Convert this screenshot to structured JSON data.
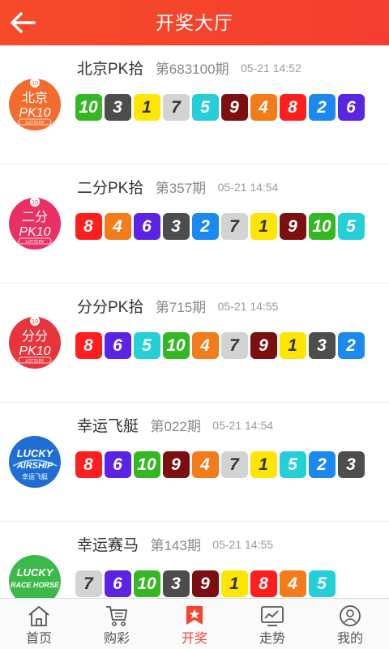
{
  "header": {
    "title": "开奖大厅",
    "back_icon": "arrow-left-icon"
  },
  "colors": {
    "accent": "#f4452e"
  },
  "lotteries": [
    {
      "name": "北京PK拾",
      "issue": "第683100期",
      "time": "05-21 14:52",
      "logo": {
        "line1": "北京",
        "line2": "PK10",
        "line3": "LOTTERY",
        "color": "#f26d2d"
      },
      "numbers": [
        "10",
        "3",
        "1",
        "7",
        "5",
        "9",
        "4",
        "8",
        "2",
        "6"
      ]
    },
    {
      "name": "二分PK拾",
      "issue": "第357期",
      "time": "05-21 14:54",
      "logo": {
        "line1": "二分",
        "line2": "PK10",
        "line3": "LOTTERY",
        "color": "#ea2f63"
      },
      "numbers": [
        "8",
        "4",
        "6",
        "3",
        "2",
        "7",
        "1",
        "9",
        "10",
        "5"
      ]
    },
    {
      "name": "分分PK拾",
      "issue": "第715期",
      "time": "05-21 14:55",
      "logo": {
        "line1": "分分",
        "line2": "PK10",
        "line3": "LOTTERY",
        "color": "#e7353d"
      },
      "numbers": [
        "8",
        "6",
        "5",
        "10",
        "4",
        "7",
        "9",
        "1",
        "3",
        "2"
      ]
    },
    {
      "name": "幸运飞艇",
      "issue": "第022期",
      "time": "05-21 14:54",
      "logo": {
        "line1": "LUCKY",
        "line2": "AIRSHIP",
        "line3": "幸运飞艇",
        "color": "#1f6fd3"
      },
      "numbers": [
        "8",
        "6",
        "10",
        "9",
        "4",
        "7",
        "1",
        "5",
        "2",
        "3"
      ]
    },
    {
      "name": "幸运赛马",
      "issue": "第143期",
      "time": "05-21 14:55",
      "logo": {
        "line1": "LUCKY",
        "line2": "RACE HORSE",
        "line3": "",
        "color": "#3db84a"
      },
      "numbers": [
        "7",
        "6",
        "10",
        "3",
        "9",
        "1",
        "8",
        "4",
        "5"
      ]
    }
  ],
  "tabs": [
    {
      "label": "首页",
      "icon": "home-icon",
      "active": false
    },
    {
      "label": "购彩",
      "icon": "cart-icon",
      "active": false
    },
    {
      "label": "开奖",
      "icon": "award-icon",
      "active": true
    },
    {
      "label": "走势",
      "icon": "trend-chart-icon",
      "active": false
    },
    {
      "label": "我的",
      "icon": "user-icon",
      "active": false
    }
  ]
}
